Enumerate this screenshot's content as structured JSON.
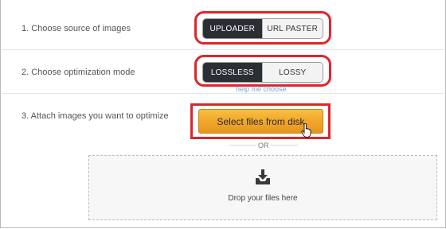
{
  "steps": [
    {
      "label": "1. Choose source of images"
    },
    {
      "label": "2. Choose optimization mode"
    },
    {
      "label": "3. Attach images you want to optimize"
    }
  ],
  "source_toggle": {
    "active": "UPLOADER",
    "inactive": "URL PASTER"
  },
  "mode_toggle": {
    "active": "LOSSLESS",
    "inactive": "LOSSY"
  },
  "help_link": "help me choose",
  "select_button": "Select files from disk",
  "or_text": "OR",
  "dropzone_text": "Drop your files here",
  "colors": {
    "highlight": "#e0242b",
    "button": "#f0a52a",
    "toggle_active": "#2b2f33",
    "link": "#6aa7d6"
  }
}
